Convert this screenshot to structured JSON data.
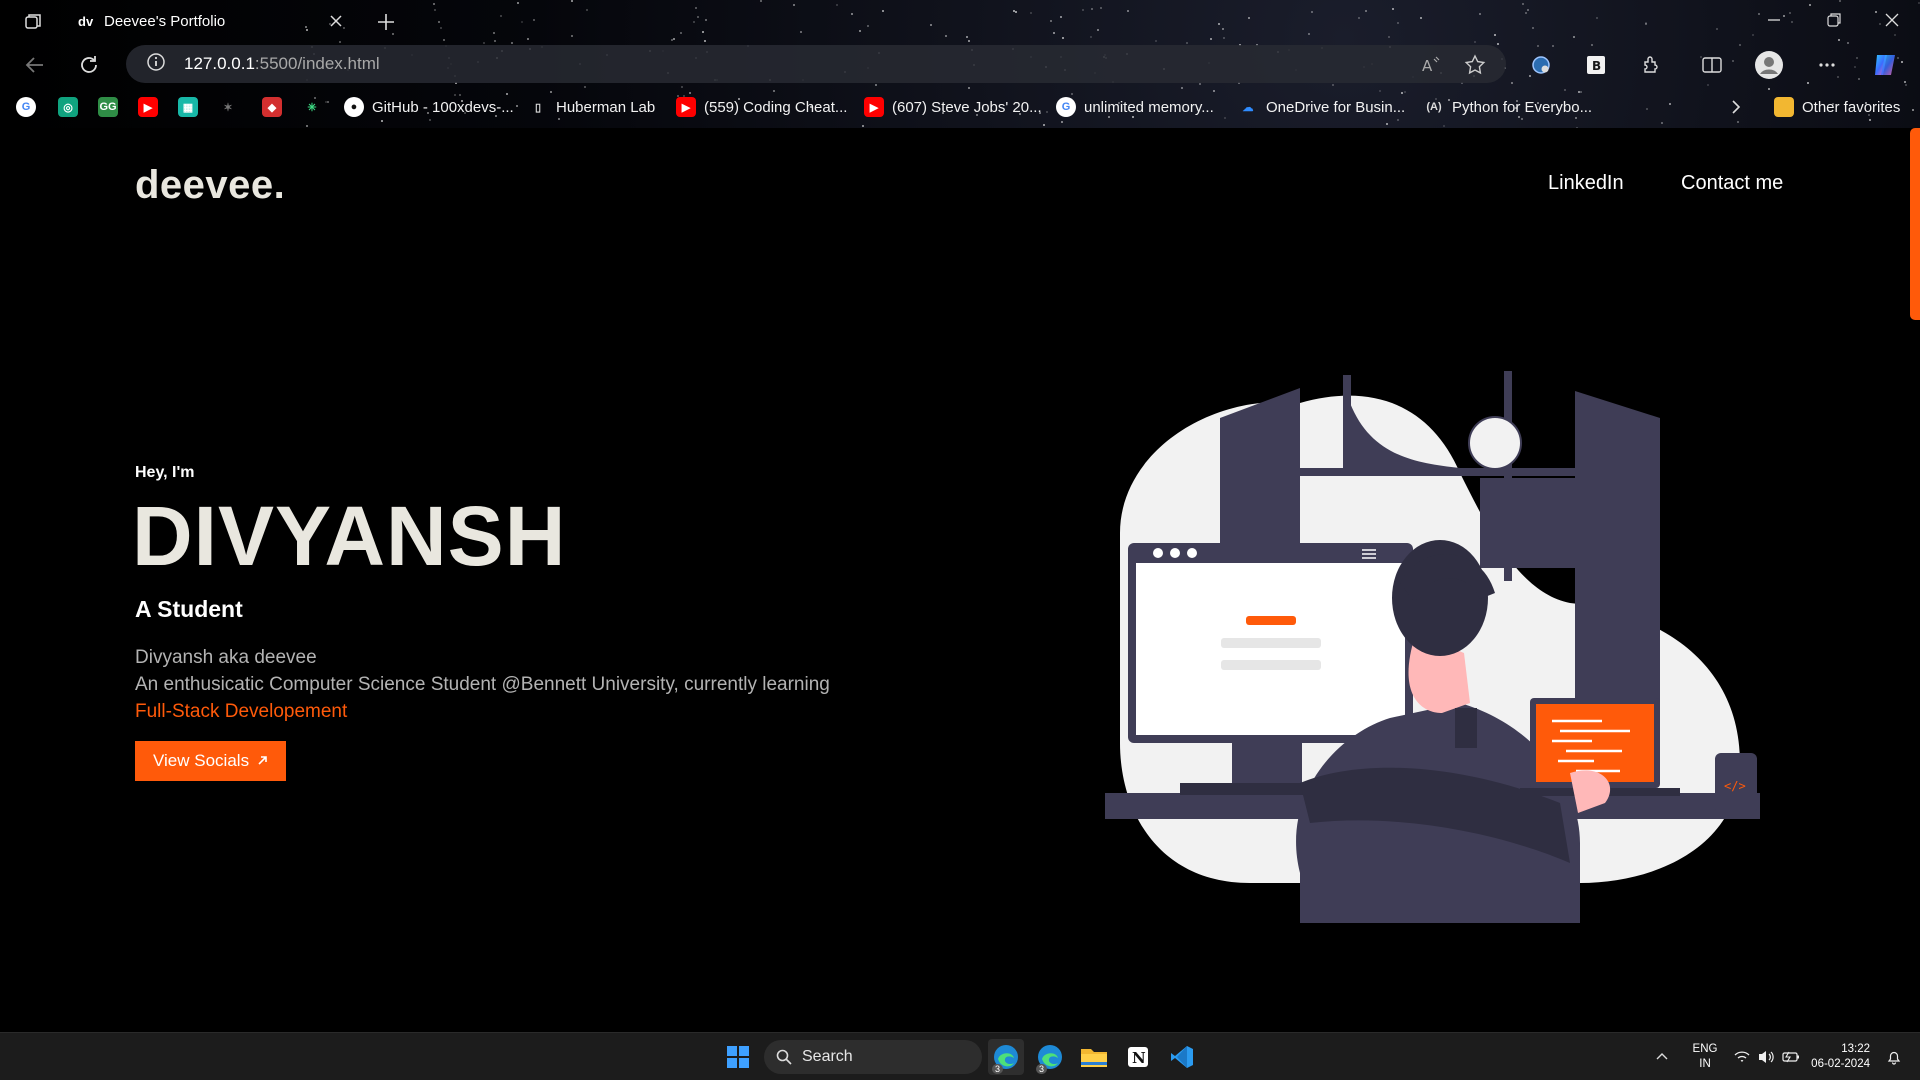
{
  "browser": {
    "tab": {
      "favicon_text": "dv",
      "title": "Deevee's Portfolio"
    },
    "address": {
      "host": "127.0.0.1",
      "path": ":5500/index.html"
    },
    "bookmarks": [
      {
        "label": "",
        "icon": "google-icon"
      },
      {
        "label": "",
        "icon": "chatgpt-icon"
      },
      {
        "label": "",
        "icon": "gfg-icon"
      },
      {
        "label": "",
        "icon": "youtube-icon"
      },
      {
        "label": "",
        "icon": "app-icon"
      },
      {
        "label": "",
        "icon": "scorpion-icon"
      },
      {
        "label": "",
        "icon": "shield-icon"
      },
      {
        "label": "",
        "icon": "perplexity-icon"
      },
      {
        "label": "GitHub - 100xdevs-...",
        "icon": "github-icon"
      },
      {
        "label": "Huberman Lab",
        "icon": "document-icon"
      },
      {
        "label": "(559) Coding Cheat...",
        "icon": "youtube-icon"
      },
      {
        "label": "(607) Steve Jobs' 20...",
        "icon": "youtube-icon"
      },
      {
        "label": "unlimited memory...",
        "icon": "google-icon"
      },
      {
        "label": "OneDrive for Busin...",
        "icon": "onedrive-icon"
      },
      {
        "label": "Python for Everybo...",
        "icon": "python-course-icon"
      },
      {
        "label": "Other favorites",
        "icon": "folder-icon"
      }
    ]
  },
  "page": {
    "logo": "deevee.",
    "nav": {
      "linkedin": "LinkedIn",
      "contact": "Contact me"
    },
    "hero": {
      "greeting": "Hey, I'm",
      "name": "DIVYANSH",
      "role": "A Student",
      "line1": "Divyansh aka deevee",
      "line2_prefix": "An enthusicatic Computer Science Student @Bennett University, currently learning ",
      "line2_accent": "Full-Stack Developement",
      "cta": "View Socials",
      "cta_icon": "arrow-up-right-icon"
    },
    "colors": {
      "accent": "#ff5a0a",
      "logo": "#e9e7df",
      "background": "#000000",
      "illustration_dark": "#3f3d56",
      "illustration_light": "#f2f2f2"
    }
  },
  "taskbar": {
    "search_placeholder": "Search",
    "language": {
      "line1": "ENG",
      "line2": "IN"
    },
    "time": "13:22",
    "date": "06-02-2024",
    "badges": {
      "edge_main": "3",
      "edge_alt": "3"
    }
  }
}
